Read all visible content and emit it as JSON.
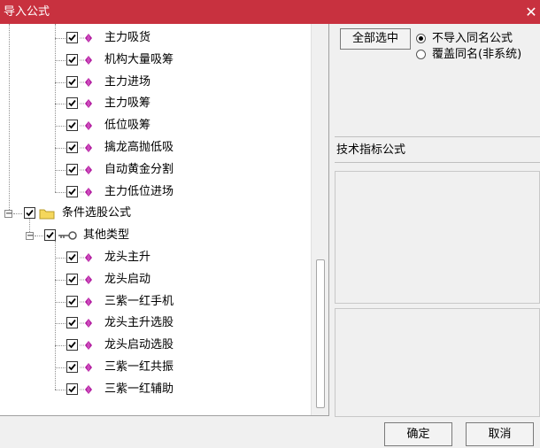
{
  "title": "导入公式",
  "close_glyph": "✕",
  "tree": {
    "top_items": [
      {
        "label": "主力吸货",
        "checked": true
      },
      {
        "label": "机构大量吸筹",
        "checked": true
      },
      {
        "label": "主力进场",
        "checked": true
      },
      {
        "label": "主力吸筹",
        "checked": true
      },
      {
        "label": "低位吸筹",
        "checked": true
      },
      {
        "label": "擒龙高抛低吸",
        "checked": true
      },
      {
        "label": "自动黄金分割",
        "checked": true
      },
      {
        "label": "主力低位进场",
        "checked": true
      }
    ],
    "group": {
      "label": "条件选股公式",
      "checked": true,
      "expander": "−"
    },
    "subgroup": {
      "label": "其他类型",
      "checked": true,
      "expander": "−"
    },
    "sub_items": [
      {
        "label": "龙头主升",
        "checked": true
      },
      {
        "label": "龙头启动",
        "checked": true
      },
      {
        "label": "三紫一红手机",
        "checked": true
      },
      {
        "label": "龙头主升选股",
        "checked": true
      },
      {
        "label": "龙头启动选股",
        "checked": true
      },
      {
        "label": "三紫一红共振",
        "checked": true
      },
      {
        "label": "三紫一红辅助",
        "checked": true
      }
    ]
  },
  "options": {
    "select_all_label": "全部选中",
    "radio_no_import": "不导入同名公式",
    "radio_overwrite": "覆盖同名(非系统)",
    "selected": "no_import"
  },
  "section_label": "技术指标公式",
  "buttons": {
    "ok": "确定",
    "cancel": "取消"
  },
  "colors": {
    "title_bar": "#c8313f",
    "leaf_icon": "#b0179d",
    "folder": "#f5d75c"
  }
}
